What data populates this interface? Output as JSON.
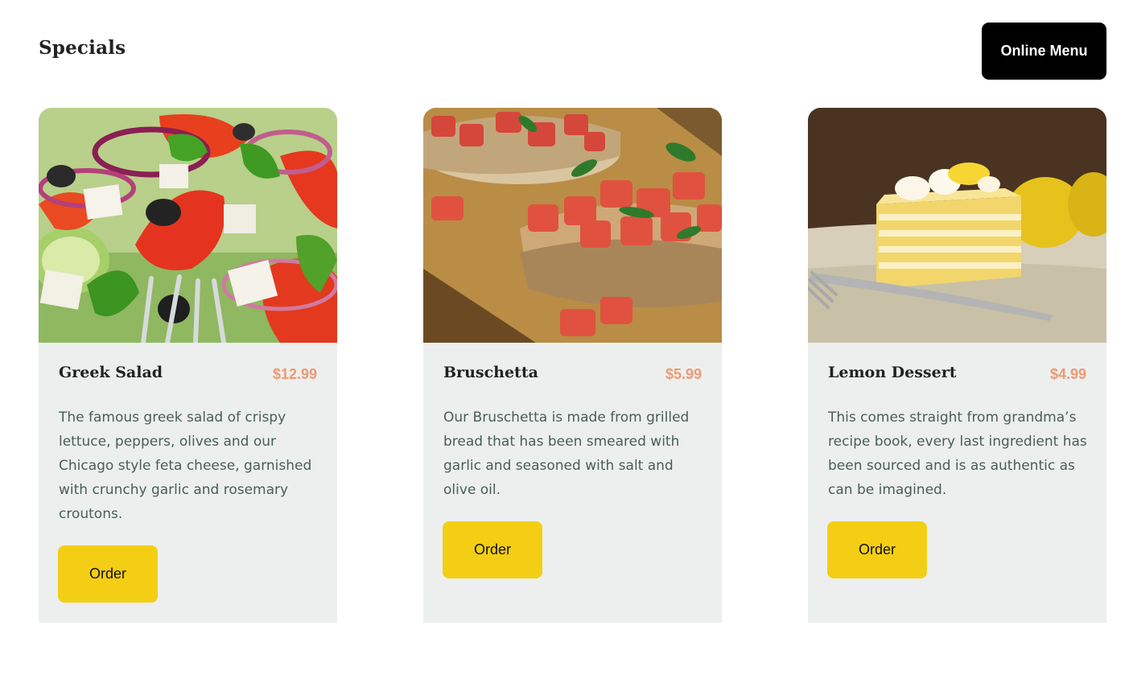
{
  "header": {
    "title": "Specials",
    "menu_button_label": "Online Menu"
  },
  "cards": [
    {
      "title": "Greek Salad",
      "price": "$12.99",
      "description": "The famous greek salad of crispy lettuce, peppers, olives and our Chicago style feta cheese, garnished with crunchy garlic and rosemary croutons.",
      "order_label": "Order",
      "image": "greek-salad-photo"
    },
    {
      "title": "Bruschetta",
      "price": "$5.99",
      "description": "Our Bruschetta is made from grilled bread that has been smeared with garlic and seasoned with salt and olive oil.",
      "order_label": "Order",
      "image": "bruschetta-photo"
    },
    {
      "title": "Lemon Dessert",
      "price": "$4.99",
      "description": "This comes straight from grandma’s recipe book, every last ingredient has been sourced and is as authentic as can be imagined.",
      "order_label": "Order",
      "image": "lemon-dessert-photo"
    }
  ],
  "colors": {
    "accent_yellow": "#f4ce14",
    "price_salmon": "#ee9972",
    "card_background": "#edefee",
    "text_green_gray": "#495e57",
    "button_black": "#000000"
  }
}
